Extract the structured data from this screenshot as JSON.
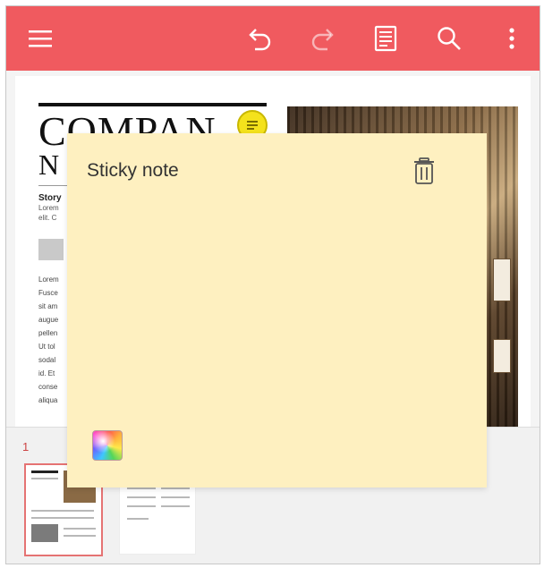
{
  "colors": {
    "toolbar": "#f05a5f",
    "toolbar_icon": "#ffffff",
    "sticky_bg": "#fef0c0",
    "comment_pin": "#f4e21c",
    "selected_thumb_border": "#e57373"
  },
  "toolbar": {
    "icons": [
      "menu-icon",
      "undo-icon",
      "redo-icon",
      "reader-mode-icon",
      "search-icon",
      "more-vert-icon"
    ]
  },
  "document": {
    "headline_line1": "COMPAN",
    "headline_line2": "N",
    "story": "Story",
    "snippet1": "Lorem",
    "snippet2": "elit. C",
    "body_lines": [
      "Lorem",
      "Fusce",
      "sit am",
      "augue",
      "pellen",
      "Ut tol",
      "sodal",
      "id. Et",
      "conse",
      "aliqua"
    ]
  },
  "sticky_note": {
    "title": "Sticky note"
  },
  "thumbnails": {
    "page_number": "1"
  }
}
